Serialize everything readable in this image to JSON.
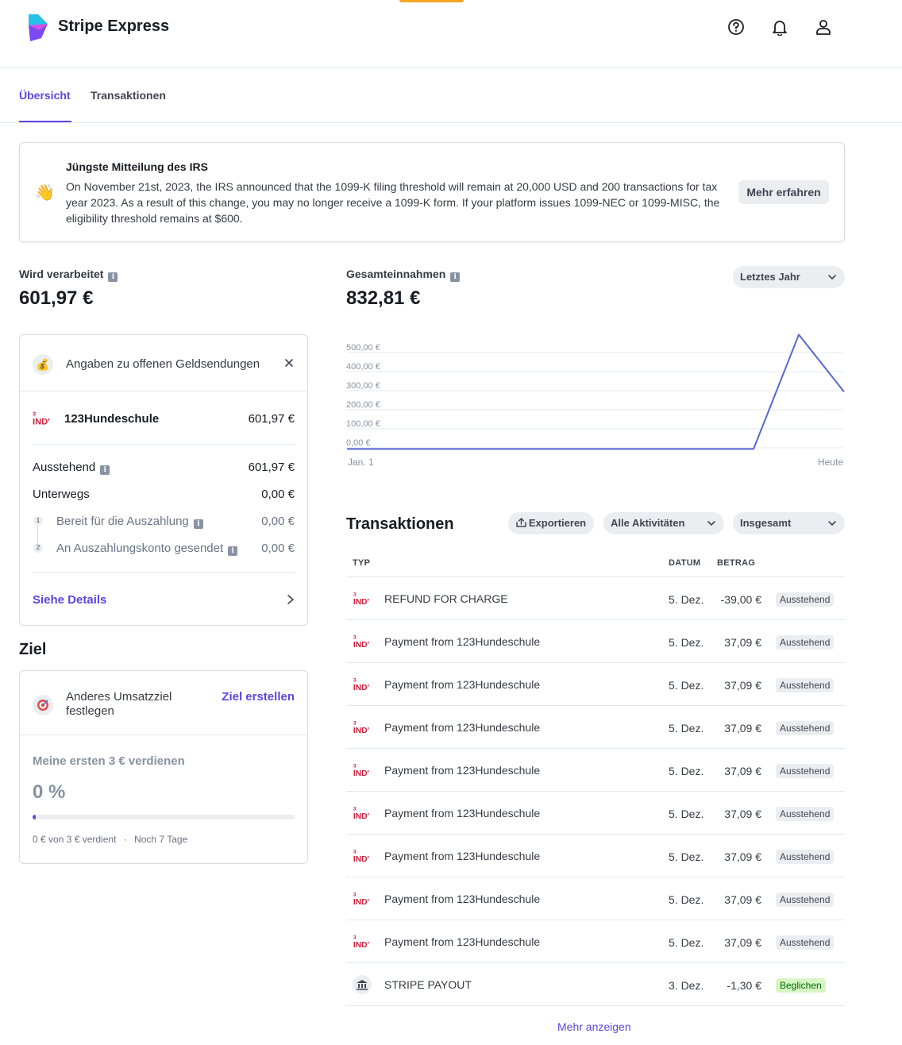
{
  "header": {
    "brand": "Stripe Express",
    "icons": [
      "help-icon",
      "bell-icon",
      "user-icon"
    ]
  },
  "tabs": [
    {
      "label": "Übersicht",
      "active": true
    },
    {
      "label": "Transaktionen",
      "active": false
    }
  ],
  "notice": {
    "title": "Jüngste Mitteilung des IRS",
    "body": "On November 21st, 2023, the IRS announced that the 1099-K filing threshold will remain at 20,000 USD and 200 transactions for tax year 2023. As a result of this change, you may no longer receive a 1099-K form. If your platform issues 1099-NEC or 1099-MISC, the eligibility threshold remains at $600.",
    "button": "Mehr erfahren",
    "emoji": "👋"
  },
  "processing": {
    "label": "Wird verarbeitet",
    "amount": "601,97 €"
  },
  "payouts_card": {
    "title": "Angaben zu offenen Geldsendungen",
    "platform_name": "123Hundeschule",
    "platform_amount": "601,97 €",
    "rows": [
      {
        "label": "Ausstehend",
        "value": "601,97 €"
      },
      {
        "label": "Unterwegs",
        "value": "0,00 €"
      }
    ],
    "steps": [
      {
        "num": "1",
        "label": "Bereit für die Auszahlung",
        "value": "0,00 €"
      },
      {
        "num": "2",
        "label": "An Auszahlungskonto gesendet",
        "value": "0,00 €"
      }
    ],
    "details_link": "Siehe Details"
  },
  "goal": {
    "section_title": "Ziel",
    "prompt": "Anderes Umsatzziel festlegen",
    "create_link": "Ziel erstellen",
    "goal_title": "Meine ersten 3 € verdienen",
    "percent": "0 %",
    "progress": 0.0,
    "footer_earned": "0 € von 3 € verdient",
    "footer_remaining": "Noch 7 Tage"
  },
  "earnings": {
    "label": "Gesamteinnahmen",
    "amount": "832,81 €",
    "range_select": "Letztes Jahr"
  },
  "chart_data": {
    "type": "line",
    "x": [
      "Jan. 1",
      "",
      "",
      "",
      "",
      "",
      "",
      "",
      "",
      "",
      "",
      "",
      "",
      "",
      "",
      "",
      "",
      "",
      "",
      "",
      "",
      "",
      "",
      "",
      "",
      "",
      "",
      "",
      "",
      "",
      "",
      "",
      "",
      "",
      "",
      "",
      "",
      "",
      "",
      "",
      "",
      "",
      "",
      "",
      "",
      "",
      "",
      "",
      "",
      "Heute"
    ],
    "x_tick_labels": [
      "Jan. 1",
      "Heute"
    ],
    "y_tick_labels": [
      "500,00 €",
      "400,00 €",
      "300,00 €",
      "200,00 €",
      "100,00 €",
      "0,00 €"
    ],
    "ylim": [
      0,
      500
    ],
    "series": [
      {
        "points": [
          [
            0,
            -35
          ],
          [
            0.818,
            -35
          ],
          [
            0.909,
            565
          ],
          [
            1.0,
            265
          ]
        ]
      }
    ],
    "color": "#5469d4"
  },
  "transactions": {
    "title": "Transaktionen",
    "export_button": "Exportieren",
    "filter_activity": "Alle Aktivitäten",
    "filter_total": "Insgesamt",
    "columns": {
      "type": "TYP",
      "date": "DATUM",
      "amount": "BETRAG"
    },
    "rows": [
      {
        "type": "REFUND FOR CHARGE",
        "date": "5. Dez.",
        "amount": "-39,00 €",
        "status": "Ausstehend",
        "kind": "pending",
        "icon": "ind-logo"
      },
      {
        "type": "Payment from 123Hundeschule",
        "date": "5. Dez.",
        "amount": "37,09 €",
        "status": "Ausstehend",
        "kind": "pending",
        "icon": "ind-logo"
      },
      {
        "type": "Payment from 123Hundeschule",
        "date": "5. Dez.",
        "amount": "37,09 €",
        "status": "Ausstehend",
        "kind": "pending",
        "icon": "ind-logo"
      },
      {
        "type": "Payment from 123Hundeschule",
        "date": "5. Dez.",
        "amount": "37,09 €",
        "status": "Ausstehend",
        "kind": "pending",
        "icon": "ind-logo"
      },
      {
        "type": "Payment from 123Hundeschule",
        "date": "5. Dez.",
        "amount": "37,09 €",
        "status": "Ausstehend",
        "kind": "pending",
        "icon": "ind-logo"
      },
      {
        "type": "Payment from 123Hundeschule",
        "date": "5. Dez.",
        "amount": "37,09 €",
        "status": "Ausstehend",
        "kind": "pending",
        "icon": "ind-logo"
      },
      {
        "type": "Payment from 123Hundeschule",
        "date": "5. Dez.",
        "amount": "37,09 €",
        "status": "Ausstehend",
        "kind": "pending",
        "icon": "ind-logo"
      },
      {
        "type": "Payment from 123Hundeschule",
        "date": "5. Dez.",
        "amount": "37,09 €",
        "status": "Ausstehend",
        "kind": "pending",
        "icon": "ind-logo"
      },
      {
        "type": "Payment from 123Hundeschule",
        "date": "5. Dez.",
        "amount": "37,09 €",
        "status": "Ausstehend",
        "kind": "pending",
        "icon": "ind-logo"
      },
      {
        "type": "STRIPE PAYOUT",
        "date": "3. Dez.",
        "amount": "-1,30 €",
        "status": "Beglichen",
        "kind": "settled",
        "icon": "bank-icon"
      }
    ],
    "more_link": "Mehr anzeigen"
  }
}
